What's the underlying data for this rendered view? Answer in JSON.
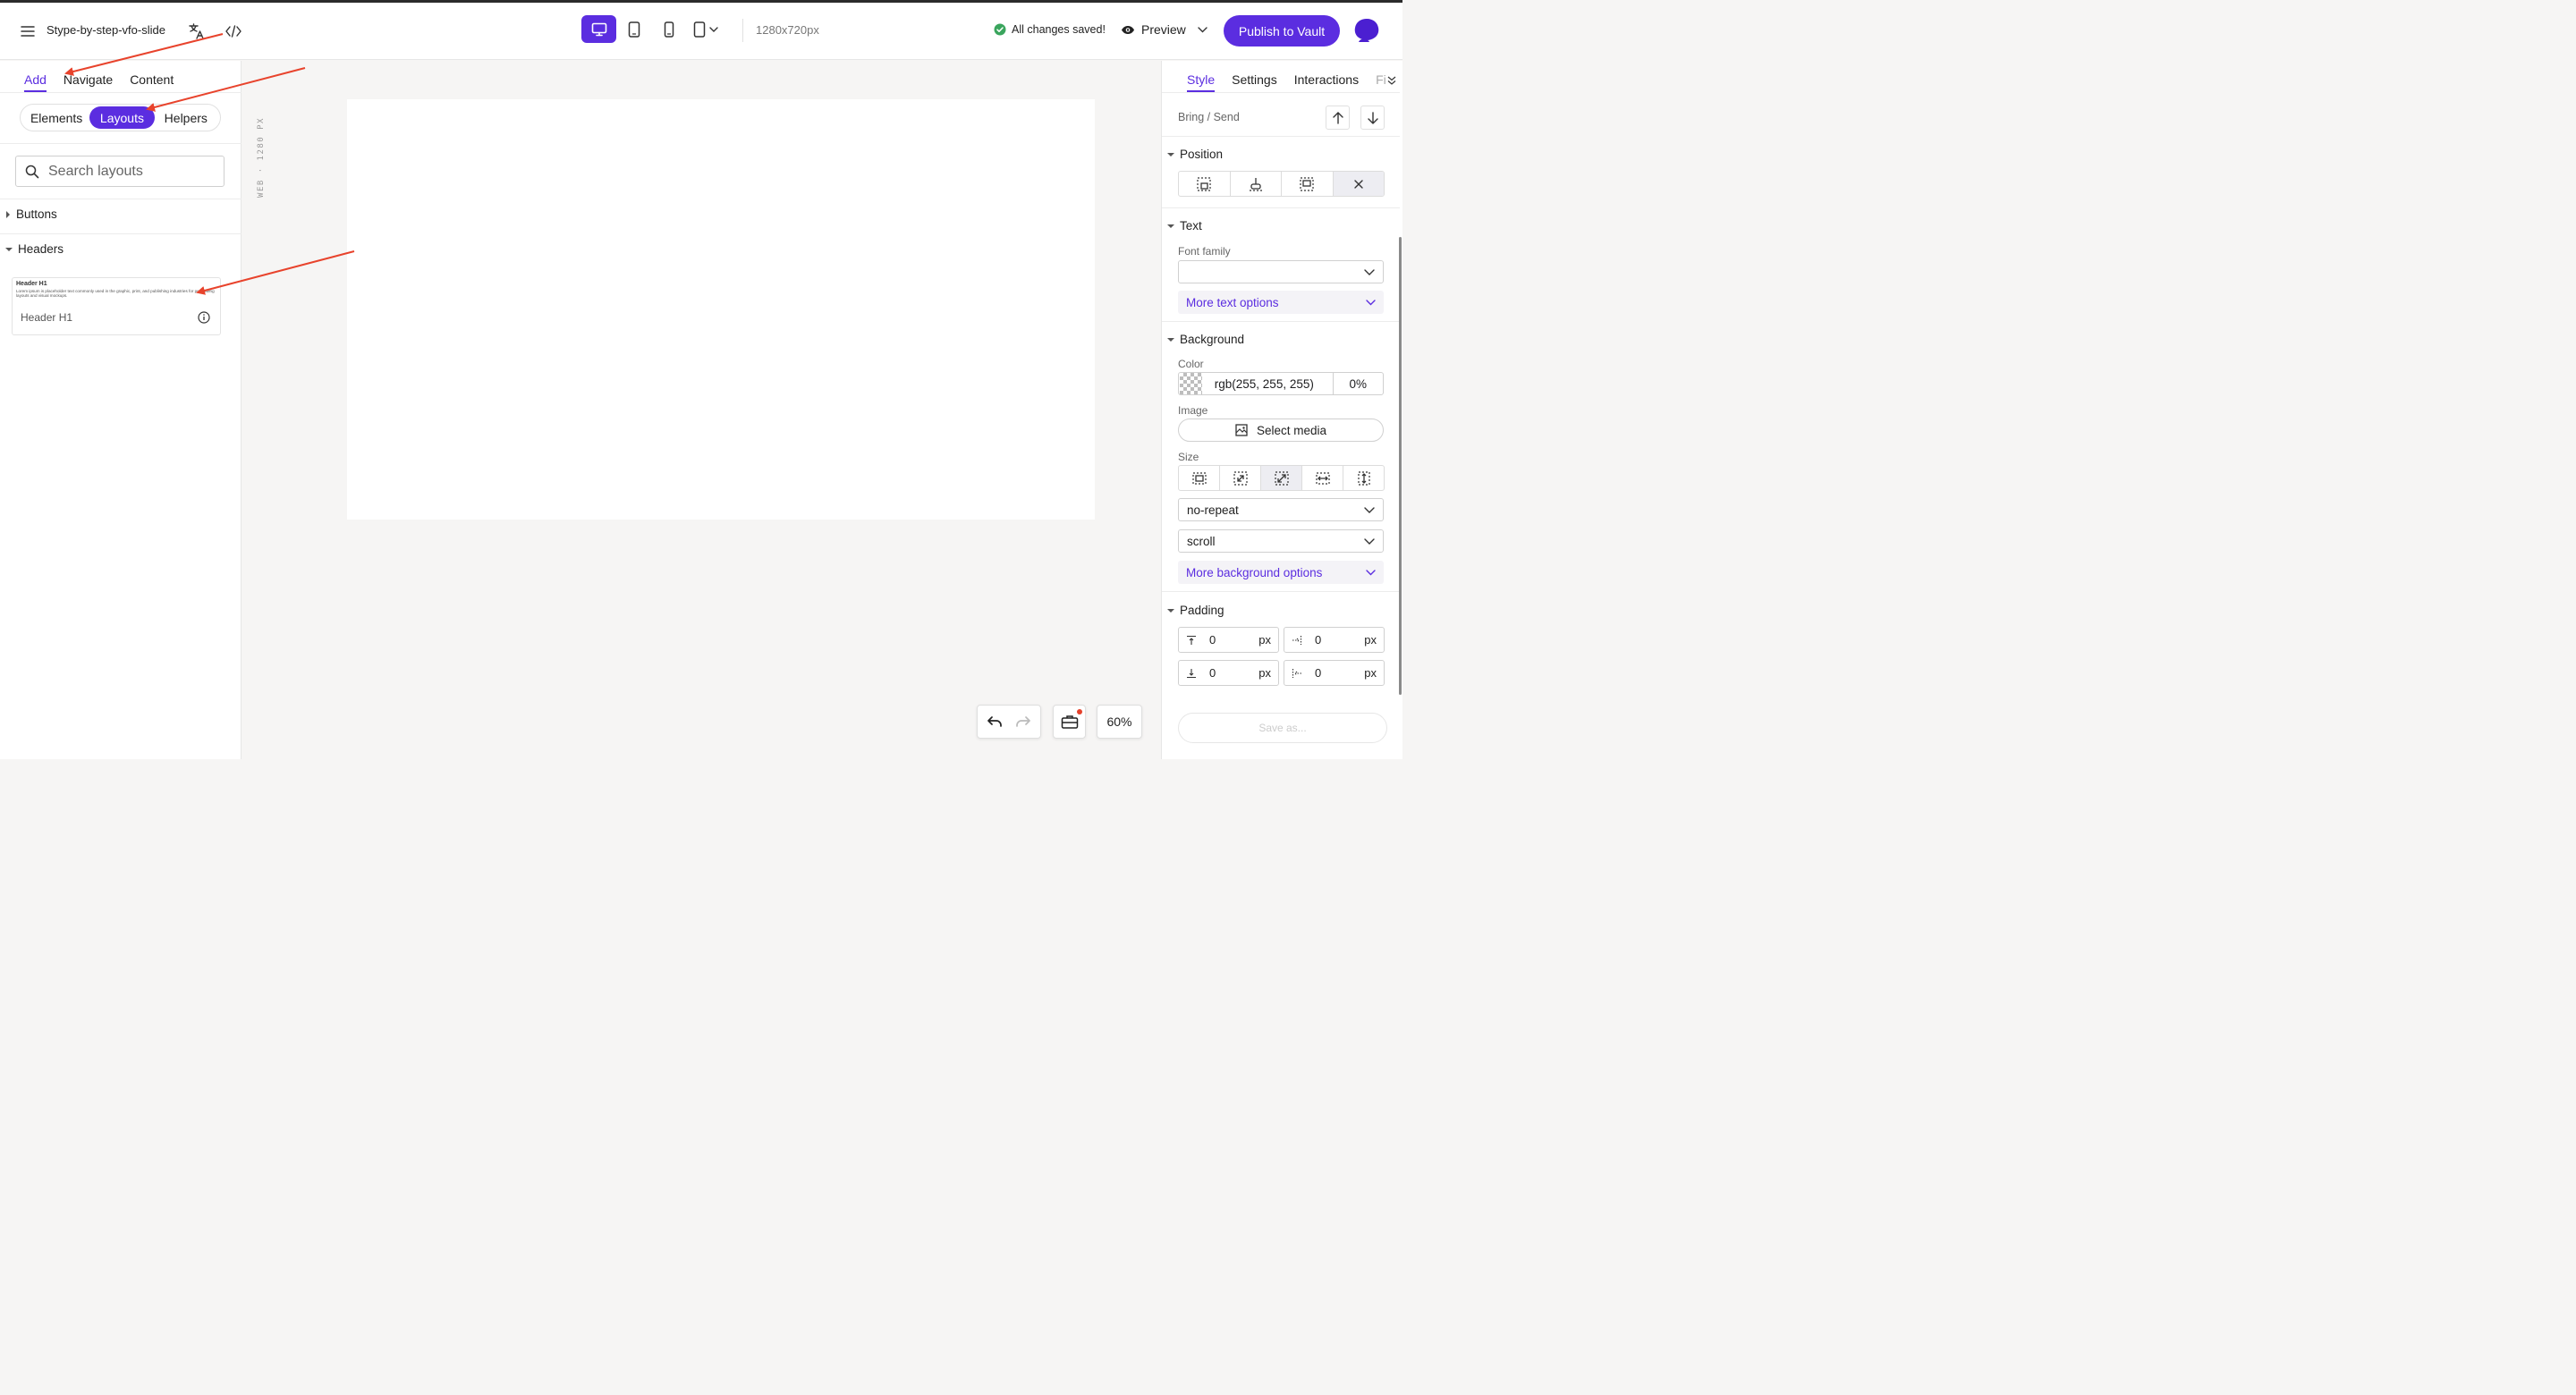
{
  "header": {
    "project_title": "Stype-by-step-vfo-slide",
    "resolution": "1280x720px",
    "save_status": "All changes saved!",
    "preview_label": "Preview",
    "publish_label": "Publish to Vault"
  },
  "left_panel": {
    "tabs": [
      "Add",
      "Navigate",
      "Content"
    ],
    "segments": [
      "Elements",
      "Layouts",
      "Helpers"
    ],
    "search_placeholder": "Search layouts",
    "sections": [
      "Buttons",
      "Headers"
    ],
    "layout_card": {
      "preview_heading": "Header H1",
      "preview_text": "Lorem ipsum is placeholder text commonly used in the graphic, print, and publishing industries for previewing layouts and visual mockups.",
      "name": "Header H1"
    }
  },
  "canvas": {
    "ruler_label": "WEB · 1280 PX",
    "zoom": "60%"
  },
  "right_panel": {
    "tabs": [
      "Style",
      "Settings",
      "Interactions",
      "Fi"
    ],
    "bring_send": "Bring / Send",
    "position_title": "Position",
    "text_title": "Text",
    "font_family_label": "Font family",
    "more_text": "More text options",
    "background_title": "Background",
    "color_label": "Color",
    "color_value": "rgb(255, 255, 255)",
    "color_alpha": "0%",
    "image_label": "Image",
    "select_media": "Select media",
    "size_label": "Size",
    "repeat_value": "no-repeat",
    "attachment_value": "scroll",
    "more_background": "More background options",
    "padding_title": "Padding",
    "padding": [
      {
        "value": "0",
        "unit": "px"
      },
      {
        "value": "0",
        "unit": "px"
      },
      {
        "value": "0",
        "unit": "px"
      },
      {
        "value": "0",
        "unit": "px"
      }
    ],
    "save_as": "Save as..."
  },
  "colors": {
    "accent": "#5b2de0",
    "annotation_arrow": "#e8432c",
    "success": "#3aa55d"
  }
}
